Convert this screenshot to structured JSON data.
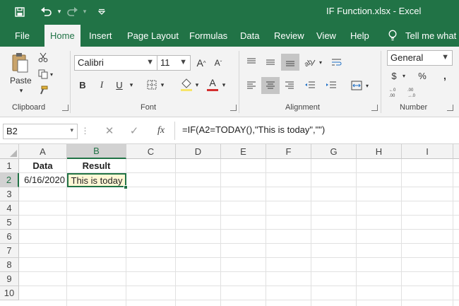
{
  "app": {
    "title": "IF Function.xlsx  -  Excel",
    "accent": "#217346"
  },
  "tabs": [
    {
      "label": "File"
    },
    {
      "label": "Home"
    },
    {
      "label": "Insert"
    },
    {
      "label": "Page Layout"
    },
    {
      "label": "Formulas"
    },
    {
      "label": "Data"
    },
    {
      "label": "Review"
    },
    {
      "label": "View"
    },
    {
      "label": "Help"
    },
    {
      "label": "Tell me what y"
    }
  ],
  "ribbon": {
    "clipboard": {
      "label": "Clipboard",
      "paste_label": "Paste"
    },
    "font": {
      "label": "Font",
      "font_name": "Calibri",
      "font_size": "11"
    },
    "alignment": {
      "label": "Alignment"
    },
    "number": {
      "label": "Number",
      "format": "General"
    }
  },
  "formula_bar": {
    "name_box": "B2",
    "fx_label": "fx",
    "formula": "=IF(A2=TODAY(),\"This is today\",\"\")"
  },
  "grid": {
    "columns": [
      "A",
      "B",
      "C",
      "D",
      "E",
      "F",
      "G",
      "H",
      "I"
    ],
    "rows": [
      "1",
      "2",
      "3",
      "4",
      "5",
      "6",
      "7",
      "8",
      "9",
      "10"
    ],
    "selected_cell": "B2",
    "cells": {
      "A1": "Data",
      "B1": "Result",
      "A2": "6/16/2020",
      "B2": "This is today"
    }
  }
}
